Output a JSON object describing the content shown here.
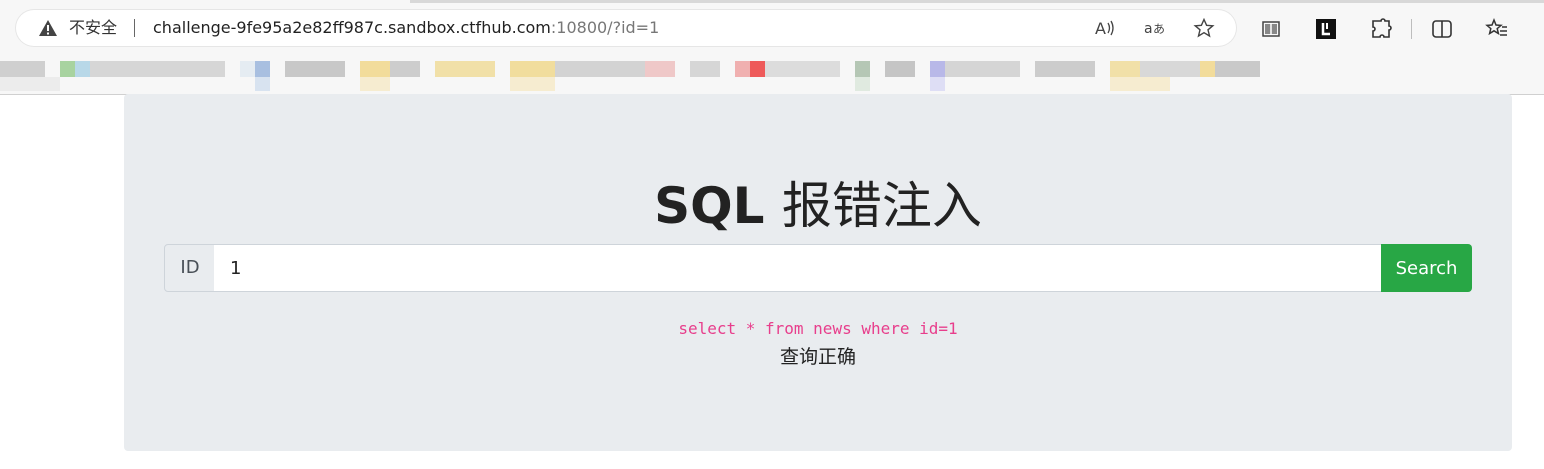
{
  "browser": {
    "security_label": "不安全",
    "url_host": "challenge-9fe95a2e82ff987c.sandbox.ctfhub.com",
    "url_path": ":10800/?id=1",
    "icons": [
      "warning-icon",
      "read-aloud-icon",
      "translate-icon",
      "favorite-star-icon",
      "reading-view-icon",
      "extension-l-icon",
      "extensions-puzzle-icon",
      "split-screen-icon",
      "favorites-icon"
    ]
  },
  "page": {
    "title_latin": "SQL",
    "title_cjk": "报错注入",
    "input_addon": "ID",
    "input_value": "1",
    "search_label": "Search",
    "sql_query": "select * from news where id=1",
    "result_text": "查询正确"
  },
  "colors": {
    "search_button": "#28a745",
    "sql_text": "#e83e8c",
    "jumbotron_bg": "#e9ecef"
  }
}
